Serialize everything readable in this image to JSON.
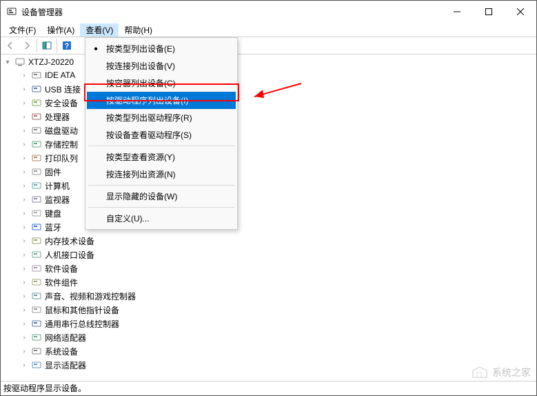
{
  "window": {
    "title": "设备管理器"
  },
  "menubar": {
    "file": "文件(F)",
    "action": "操作(A)",
    "view": "查看(V)",
    "help": "帮助(H)"
  },
  "tree": {
    "root": "XTZJ-20220",
    "items": [
      "IDE ATA",
      "USB 连接",
      "安全设备",
      "处理器",
      "磁盘驱动",
      "存储控制",
      "打印队列",
      "固件",
      "计算机",
      "监视器",
      "键盘",
      "蓝牙",
      "内存技术设备",
      "人机接口设备",
      "软件设备",
      "软件组件",
      "声音、视频和游戏控制器",
      "鼠标和其他指针设备",
      "通用串行总线控制器",
      "网络适配器",
      "系统设备",
      "显示适配器"
    ]
  },
  "view_menu": {
    "items": [
      "按类型列出设备(E)",
      "按连接列出设备(V)",
      "按容器列出设备(C)",
      "按驱动程序列出设备(I)",
      "按类型列出驱动程序(R)",
      "按设备查看驱动程序(S)",
      "按类型查看资源(Y)",
      "按连接列出资源(N)",
      "显示隐藏的设备(W)",
      "自定义(U)..."
    ],
    "highlighted_index": 3,
    "bullet_index": 0
  },
  "statusbar": {
    "text": "按驱动程序显示设备。"
  },
  "watermark": {
    "text": "系统之家"
  }
}
